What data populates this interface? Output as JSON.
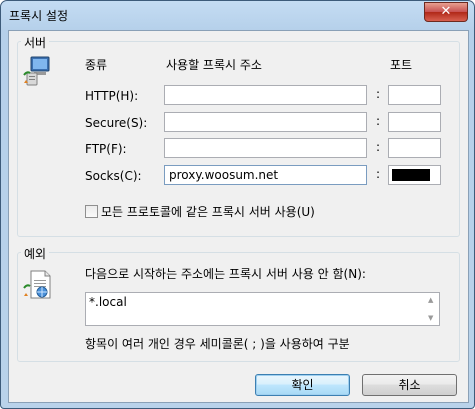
{
  "window": {
    "title": "프록시 설정",
    "close_glyph": "✕"
  },
  "servers": {
    "legend": "서버",
    "icon": "network-computer-icon",
    "type_header": "종류",
    "address_header": "사용할 프록시 주소",
    "port_header": "포트",
    "rows": [
      {
        "label": "HTTP(H):",
        "address": "",
        "port": ""
      },
      {
        "label": "Secure(S):",
        "address": "",
        "port": ""
      },
      {
        "label": "FTP(F):",
        "address": "",
        "port": ""
      },
      {
        "label": "Socks(C):",
        "address": "proxy.woosum.net",
        "port": ""
      }
    ],
    "colon": ":",
    "same_proxy_label": "모든 프로토콜에 같은 프록시 서버 사용(U)",
    "same_proxy_checked": false
  },
  "exceptions": {
    "legend": "예외",
    "icon": "document-globe-icon",
    "instruction": "다음으로 시작하는 주소에는 프록시 서버 사용 안 함(N):",
    "value": "*.local",
    "hint": "항목이 여러 개인 경우 세미콜론( ; )을 사용하여 구분"
  },
  "buttons": {
    "ok": "확인",
    "cancel": "취소"
  },
  "colors": {
    "socks_port_fill": "#000000",
    "title_gradient_top": "#c4dcf3"
  }
}
